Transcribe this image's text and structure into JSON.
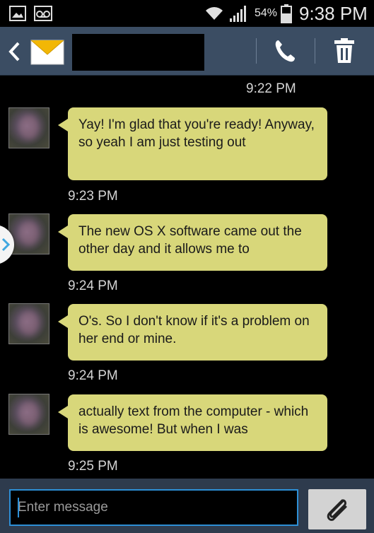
{
  "status_bar": {
    "battery": "54%",
    "time": "9:38 PM",
    "icons": [
      "gallery-icon",
      "voicemail-icon",
      "wifi-icon",
      "signal-icon",
      "battery-icon"
    ]
  },
  "header": {
    "icons": [
      "back-icon",
      "envelope-icon",
      "phone-icon",
      "trash-icon"
    ]
  },
  "messages": [
    {
      "time": "9:22 PM",
      "text": "Yay! I'm glad that you're ready! Anyway, so yeah I am just testing out"
    },
    {
      "time": "9:23 PM",
      "text": "The new OS X software came out the other day and it allows me to"
    },
    {
      "time": "9:24 PM",
      "text": "O's. So I don't know if it's a problem on her end or mine."
    },
    {
      "time": "9:24 PM",
      "text": "actually text from the computer - which is awesome! But when I was"
    },
    {
      "time": "9:25 PM"
    }
  ],
  "composer": {
    "placeholder": "Enter message",
    "attach_icon": "paperclip-icon"
  },
  "colors": {
    "actionbar": "#3b4d63",
    "bubble": "#d8d77a",
    "accent": "#2d8fd6"
  }
}
